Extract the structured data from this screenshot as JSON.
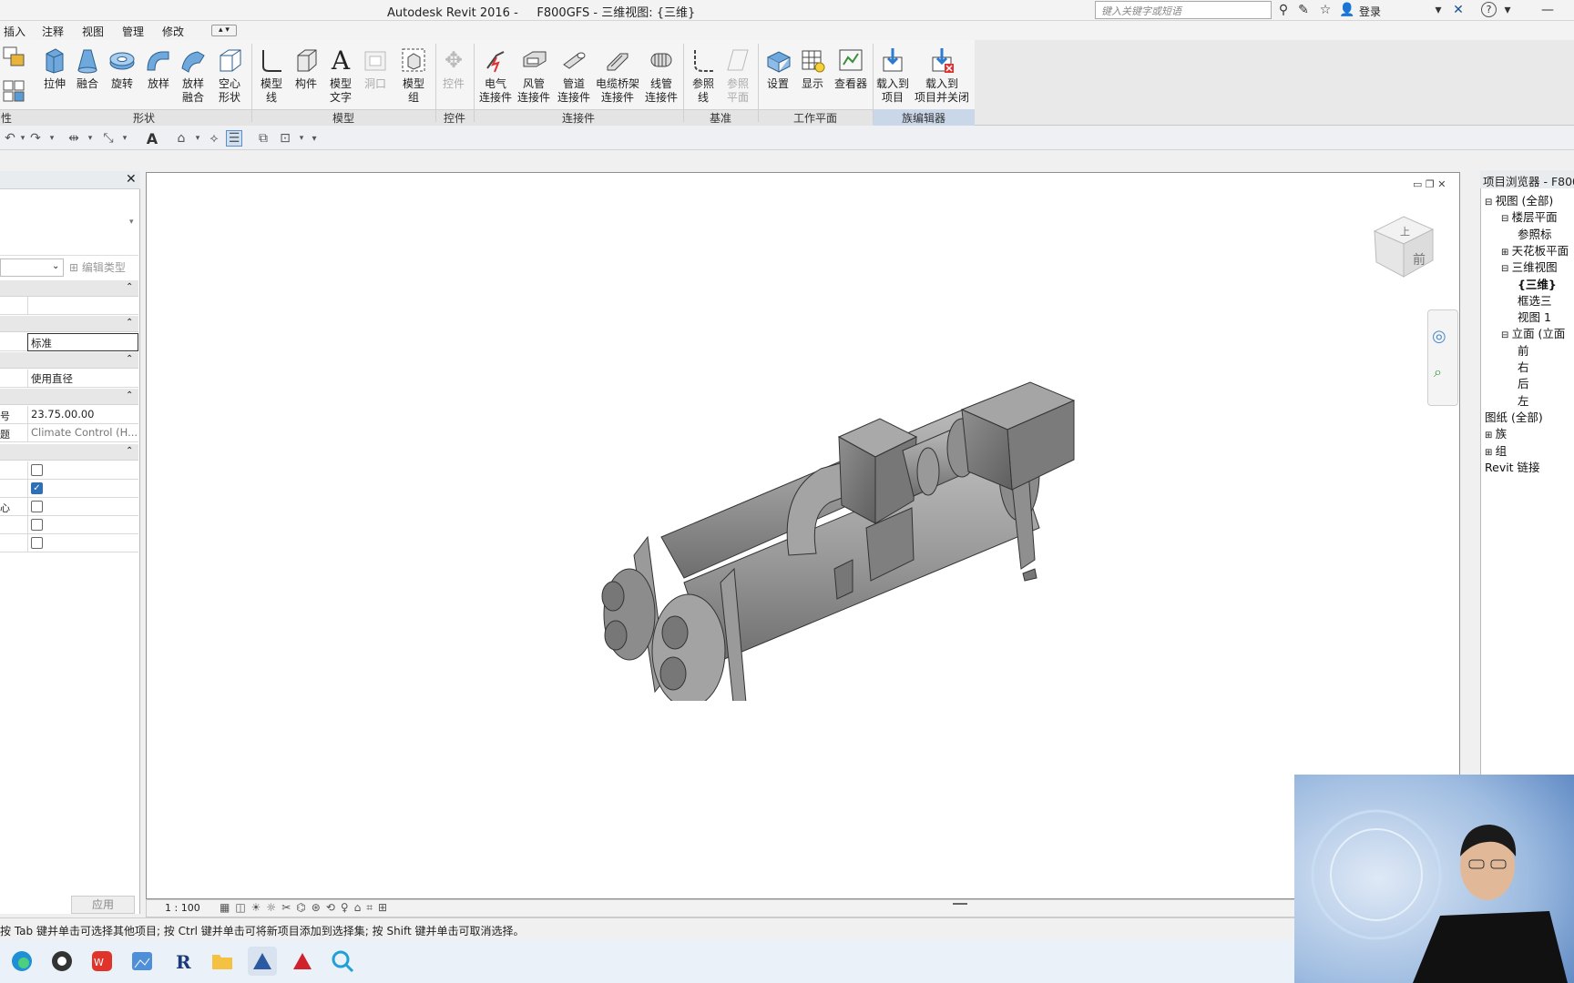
{
  "window": {
    "title": "Autodesk Revit 2016 -     F800GFS - 三维视图: {三维}",
    "search_placeholder": "键入关键字或短语",
    "login_label": "登录"
  },
  "menu": {
    "items": [
      "插入",
      "注释",
      "视图",
      "管理",
      "修改"
    ]
  },
  "ribbon": {
    "buttons": {
      "extrude": "拉伸",
      "blend": "融合",
      "revolve": "旋转",
      "sweep": "放样",
      "swept_blend_1": "放样",
      "swept_blend_2": "融合",
      "void_1": "空心",
      "void_2": "形状",
      "model_line_1": "模型",
      "model_line_2": "线",
      "component": "构件",
      "model_text_1": "模型",
      "model_text_2": "文字",
      "opening": "洞口",
      "model_group_1": "模型",
      "model_group_2": "组",
      "control": "控件",
      "elec_conn_1": "电气",
      "elec_conn_2": "连接件",
      "duct_conn_1": "风管",
      "duct_conn_2": "连接件",
      "pipe_conn_1": "管道",
      "pipe_conn_2": "连接件",
      "tray_conn_1": "电缆桥架",
      "tray_conn_2": "连接件",
      "conduit_conn_1": "线管",
      "conduit_conn_2": "连接件",
      "ref_line_1": "参照",
      "ref_line_2": "线",
      "ref_plane_1": "参照",
      "ref_plane_2": "平面",
      "set": "设置",
      "show": "显示",
      "viewer": "查看器",
      "load_1": "载入到",
      "load_2": "项目",
      "load_close_1": "载入到",
      "load_close_2": "项目并关闭"
    },
    "panels": {
      "attr": "性",
      "forms": "形状",
      "model": "模型",
      "controls": "控件",
      "connectors": "连接件",
      "datum": "基准",
      "work_plane": "工作平面",
      "family_editor": "族编辑器"
    }
  },
  "properties": {
    "edit_type": "编辑类型",
    "row_standard": "标准",
    "row_use_diameter": "使用直径",
    "row_number_label": "号",
    "row_number": "23.75.00.00",
    "row_category_label": "题",
    "row_category": "Climate Control (H...",
    "row_center_label": "心",
    "checkbox_states": [
      false,
      true,
      false,
      false,
      false
    ],
    "apply": "应用"
  },
  "view": {
    "scale": "1 : 100",
    "viewcube_top": "上",
    "viewcube_front": "前"
  },
  "browser": {
    "title": "项目浏览器 - F800",
    "items": [
      {
        "label": "视图 (全部)",
        "level": 0
      },
      {
        "label": "楼层平面",
        "level": 1
      },
      {
        "label": "参照标",
        "level": 2
      },
      {
        "label": "天花板平面",
        "level": 1
      },
      {
        "label": "三维视图",
        "level": 1
      },
      {
        "label": "{三维}",
        "level": 2
      },
      {
        "label": "框选三",
        "level": 2
      },
      {
        "label": "视图 1",
        "level": 2
      },
      {
        "label": "立面 (立面",
        "level": 1
      },
      {
        "label": "前",
        "level": 2
      },
      {
        "label": "右",
        "level": 2
      },
      {
        "label": "后",
        "level": 2
      },
      {
        "label": "左",
        "level": 2
      },
      {
        "label": "图纸 (全部)",
        "level": 0
      },
      {
        "label": "族",
        "level": 0
      },
      {
        "label": "组",
        "level": 0
      },
      {
        "label": "Revit 链接",
        "level": 0
      }
    ]
  },
  "status": {
    "text": "按 Tab 键并单击可选择其他项目; 按 Ctrl 键并单击可将新项目添加到选择集; 按 Shift 键并单击可取消选择。"
  },
  "colors": {
    "accent": "#2f6fb7",
    "model_gray": "#8c8c8c"
  }
}
